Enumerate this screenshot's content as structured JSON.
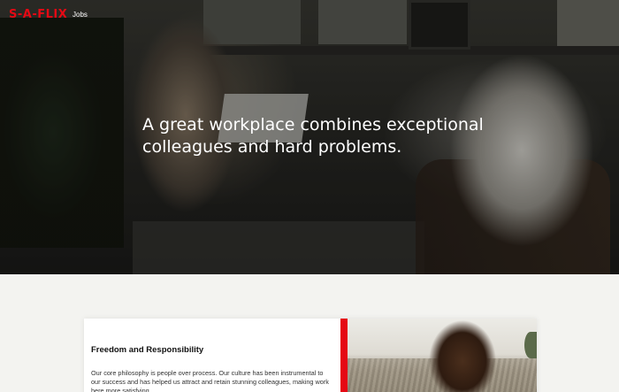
{
  "header": {
    "brand": "S-A-FLIX",
    "nav": [
      {
        "label": "Jobs"
      }
    ]
  },
  "hero": {
    "headline": "A great workplace combines exceptional colleagues and hard problems."
  },
  "section": {
    "title": "Freedom and Responsibility",
    "body": "Our core philosophy is people over process. Our culture has been instrumental to our success and has helped us attract and retain stunning colleagues, making work here more satisfying."
  },
  "colors": {
    "brand_red": "#e50914",
    "page_bg": "#f3f3f0",
    "card_bg": "#ffffff"
  }
}
